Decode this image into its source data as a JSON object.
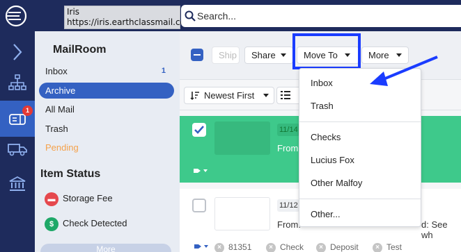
{
  "tooltip": {
    "line1": "Iris",
    "line2": "https://iris.earthclassmail.com"
  },
  "search": {
    "placeholder": "Search..."
  },
  "rail": {
    "badge_count": "1"
  },
  "sidebar": {
    "title": "MailRoom",
    "items": [
      {
        "label": "Inbox",
        "count": "1"
      },
      {
        "label": "Archive"
      },
      {
        "label": "All Mail"
      },
      {
        "label": "Trash"
      },
      {
        "label": "Pending"
      }
    ],
    "status_title": "Item Status",
    "status_items": [
      {
        "label": "Storage Fee"
      },
      {
        "label": "Check Detected"
      }
    ],
    "more_label": "More"
  },
  "toolbar": {
    "ship_label": "Ship",
    "share_label": "Share",
    "move_to_label": "Move To",
    "more_label": "More"
  },
  "sortbar": {
    "sort_label": "Newest First"
  },
  "mail": [
    {
      "date": "11/14",
      "from": "From:",
      "checked": true
    },
    {
      "date": "11/12",
      "from": "From:",
      "subject_tail": "d: See wh",
      "tags": [
        "81351",
        "Check",
        "Deposit",
        "Test"
      ]
    }
  ],
  "dropdown": {
    "items": [
      "Inbox",
      "Trash",
      "Checks",
      "Lucius Fox",
      "Other Malfoy",
      "Other..."
    ]
  },
  "colors": {
    "navy": "#1e2b5c",
    "accent": "#3461c2",
    "selected_row": "#3ec98b",
    "annotation": "#1a3cff",
    "pending": "#f5a24b"
  }
}
